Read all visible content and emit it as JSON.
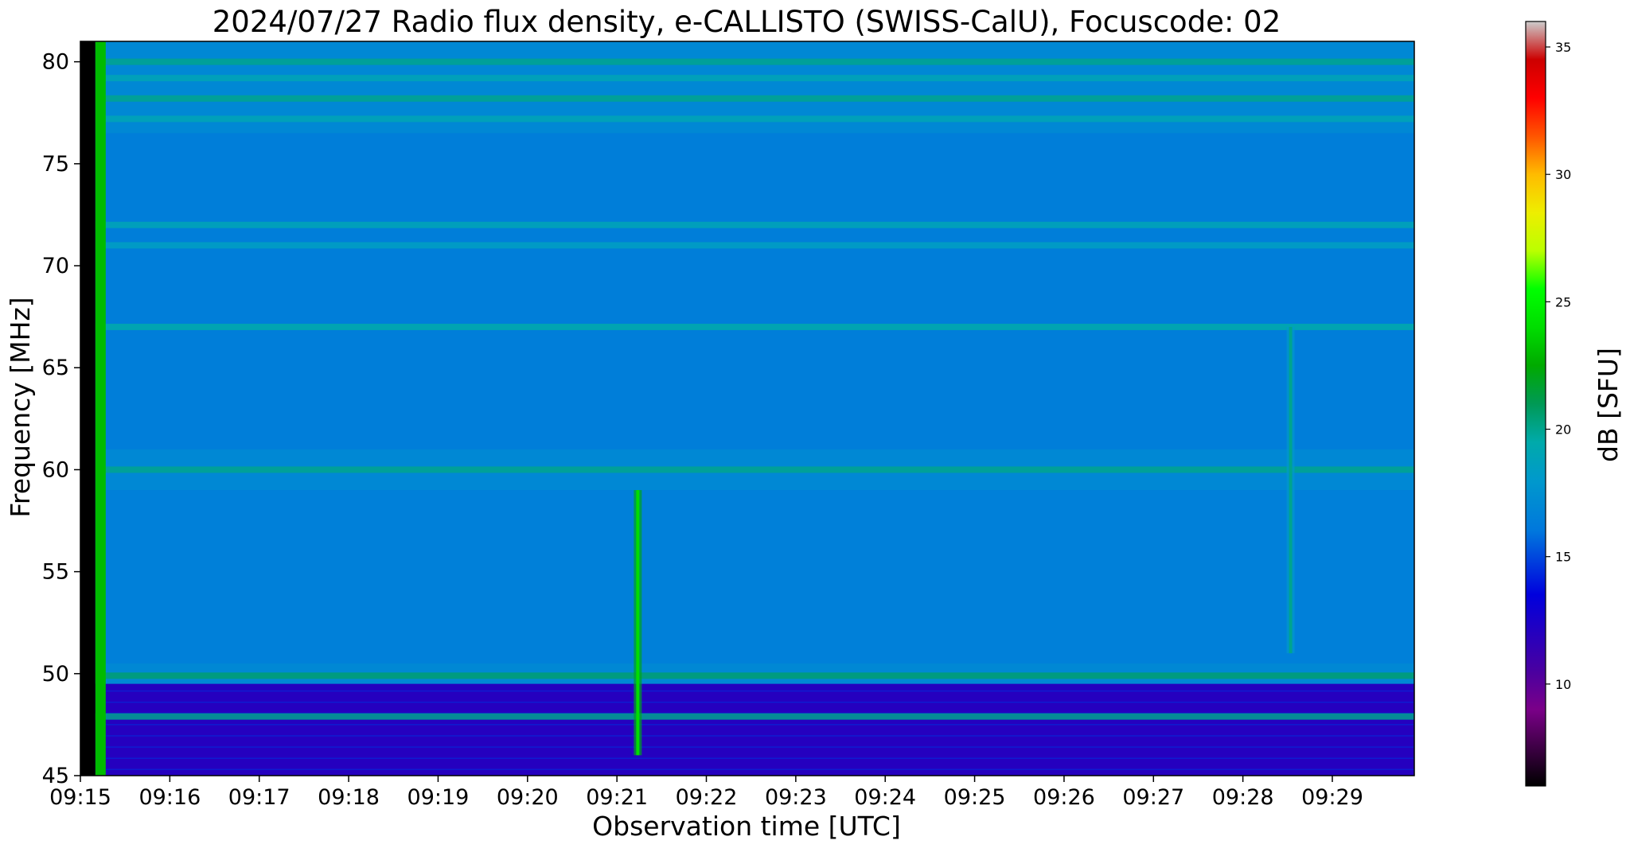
{
  "chart_data": {
    "type": "heatmap",
    "title": "2024/07/27  Radio flux density, e-CALLISTO (SWISS-CalU), Focuscode: 02",
    "xlabel": "Observation time [UTC]",
    "ylabel": "Frequency [MHz]",
    "xlim": [
      "09:15",
      "09:29:55"
    ],
    "x_ticks": [
      "09:15",
      "09:16",
      "09:17",
      "09:18",
      "09:19",
      "09:20",
      "09:21",
      "09:22",
      "09:23",
      "09:24",
      "09:25",
      "09:26",
      "09:27",
      "09:28",
      "09:29"
    ],
    "ylim": [
      45,
      81
    ],
    "y_ticks": [
      45,
      50,
      55,
      60,
      65,
      70,
      75,
      80
    ],
    "colorbar": {
      "label": "dB [SFU]",
      "range": [
        6,
        36
      ],
      "ticks": [
        10,
        15,
        20,
        25,
        30,
        35
      ],
      "colormap": "nipy_spectral"
    },
    "background_level_dB": 17,
    "data_start": "09:15:17",
    "no_data_before": "09:15:10",
    "horizontal_bands_MHz": [
      {
        "freq": 80.0,
        "level": 20
      },
      {
        "freq": 79.2,
        "level": 19
      },
      {
        "freq": 78.2,
        "level": 20
      },
      {
        "freq": 77.2,
        "level": 19
      },
      {
        "freq": 72.0,
        "level": 19
      },
      {
        "freq": 71.0,
        "level": 18.5
      },
      {
        "freq": 67.0,
        "level": 19.5
      },
      {
        "freq": 60.0,
        "level": 20
      },
      {
        "freq": 49.9,
        "level": 20.5
      },
      {
        "freq": 47.9,
        "level": 20
      }
    ],
    "low_frequency_region": {
      "from": 45,
      "to": 49.5,
      "level": 12
    },
    "events": [
      {
        "time": "09:21:14",
        "freq_from": 46,
        "freq_to": 59,
        "peak_level": 24
      },
      {
        "time": "09:28:32",
        "freq_from": 51,
        "freq_to": 67,
        "peak_level": 20
      }
    ]
  }
}
